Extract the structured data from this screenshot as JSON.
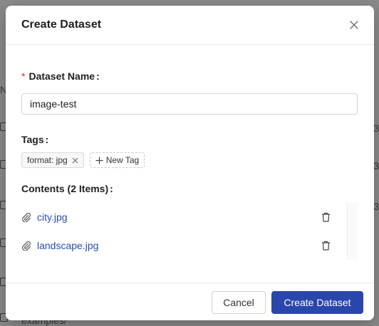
{
  "background": {
    "left_fragment": "N",
    "right_fragment": "3",
    "bottom_text": "examples/"
  },
  "modal": {
    "title": "Create Dataset",
    "close_icon": "close-icon",
    "dataset_name": {
      "label": "Dataset Name",
      "required_mark": "*",
      "colon": ":",
      "value": "image-test"
    },
    "tags": {
      "label": "Tags",
      "colon": ":",
      "items": [
        {
          "label": "format: jpg"
        }
      ],
      "new_tag_label": "New Tag"
    },
    "contents": {
      "label": "Contents (2 Items)",
      "colon": ":",
      "files": [
        {
          "name": "city.jpg"
        },
        {
          "name": "landscape.jpg"
        }
      ]
    },
    "footer": {
      "cancel_label": "Cancel",
      "submit_label": "Create Dataset"
    }
  },
  "colors": {
    "primary": "#2a46ad",
    "link": "#2a4eb0",
    "required": "#e0282e",
    "overlay": "#8a8a8a"
  }
}
